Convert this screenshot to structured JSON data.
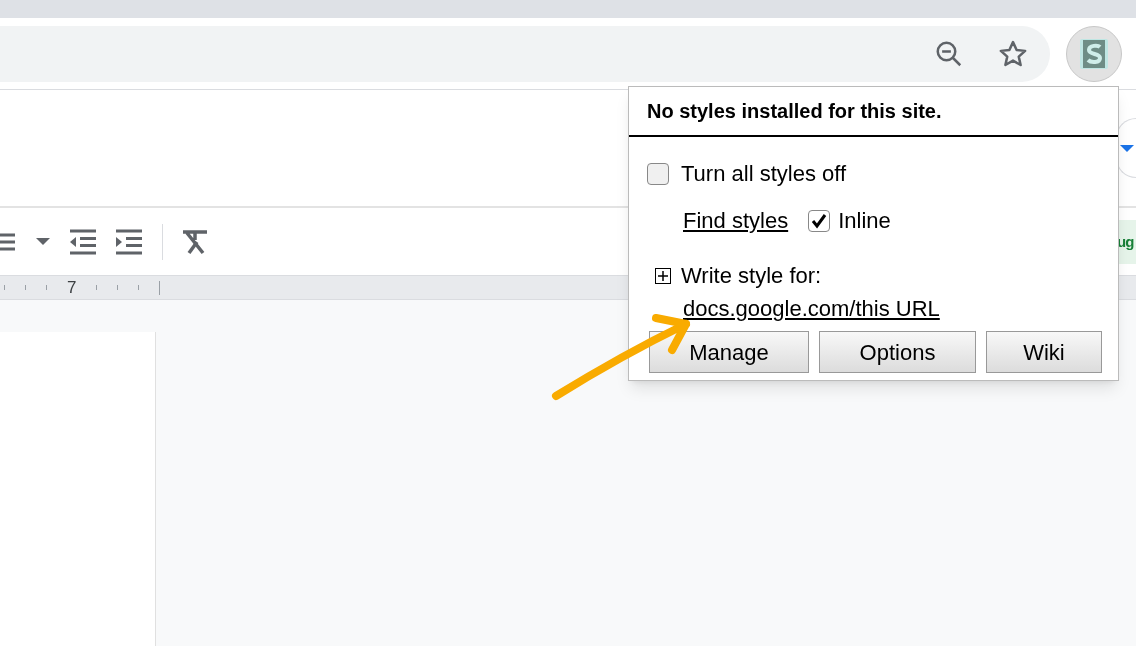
{
  "ruler": {
    "label": "7"
  },
  "side_chip": {
    "text": "ug"
  },
  "popup": {
    "title": "No styles installed for this site.",
    "styles_off": {
      "label": "Turn all styles off",
      "checked": false
    },
    "find_styles": "Find styles",
    "inline": {
      "label": "Inline",
      "checked": true
    },
    "write_style": {
      "label": "Write style for:",
      "expanded": false,
      "link": "docs.google.com/this URL"
    },
    "buttons": [
      "Manage",
      "Options",
      "Wiki"
    ]
  }
}
